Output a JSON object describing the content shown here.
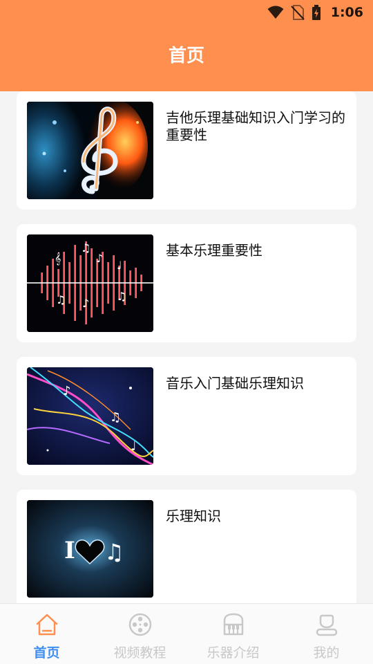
{
  "status_bar": {
    "time": "1:06",
    "icons": [
      "wifi-icon",
      "no-sim-icon",
      "battery-charging-icon"
    ]
  },
  "header": {
    "title": "首页"
  },
  "articles": [
    {
      "title": "吉他乐理基础知识入门学习的重要性",
      "thumbnail": "treble-clef-fire-water-image"
    },
    {
      "title": "基本乐理重要性",
      "thumbnail": "rainbow-soundwave-notes-image"
    },
    {
      "title": "音乐入门基础乐理知识",
      "thumbnail": "colorful-note-swirl-image"
    },
    {
      "title": "乐理知识",
      "thumbnail": "i-love-music-image"
    }
  ],
  "bottom_nav": {
    "items": [
      {
        "label": "首页",
        "icon": "home-icon",
        "active": true
      },
      {
        "label": "视频教程",
        "icon": "film-reel-icon",
        "active": false
      },
      {
        "label": "乐器介绍",
        "icon": "piano-icon",
        "active": false
      },
      {
        "label": "我的",
        "icon": "person-icon",
        "active": false
      }
    ]
  },
  "colors": {
    "header": "#ff8f4f",
    "active_tab": "#3d8ef0",
    "inactive_tab": "#c8c8c8",
    "background": "#f4f4f4"
  }
}
